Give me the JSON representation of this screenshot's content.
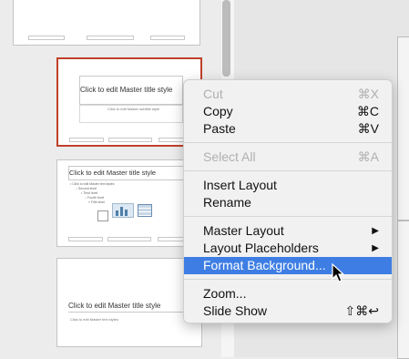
{
  "slides": {
    "thumb1_footer": [
      "",
      "",
      ""
    ],
    "thumb2_title": "Click to edit Master title style",
    "thumb2_sub": "Click to edit Master subtitle style",
    "thumb3_title": "Click to edit Master title style",
    "thumb3_bullets": [
      "• Click to edit Master text styles",
      "– Second level",
      "• Third level",
      "– Fourth level",
      "» Fifth level"
    ],
    "thumb4_title": "Click to edit Master title style",
    "thumb4_sub": "Click to edit Master text styles"
  },
  "menu": {
    "items": [
      {
        "label": "Cut",
        "shortcut": "⌘X",
        "disabled": true
      },
      {
        "label": "Copy",
        "shortcut": "⌘C"
      },
      {
        "label": "Paste",
        "shortcut": "⌘V"
      },
      {
        "label": "Select All",
        "shortcut": "⌘A",
        "disabled": true
      },
      {
        "label": "Insert Layout"
      },
      {
        "label": "Rename"
      },
      {
        "label": "Master Layout",
        "submenu": true
      },
      {
        "label": "Layout Placeholders",
        "submenu": true
      },
      {
        "label": "Format Background...",
        "highlighted": true
      },
      {
        "label": "Zoom..."
      },
      {
        "label": "Slide Show",
        "shortcut": "⇧⌘↩"
      }
    ],
    "submenu_arrow": "▶",
    "highlight_color": "#3e7ee4",
    "selected_border_color": "#c0402a"
  }
}
